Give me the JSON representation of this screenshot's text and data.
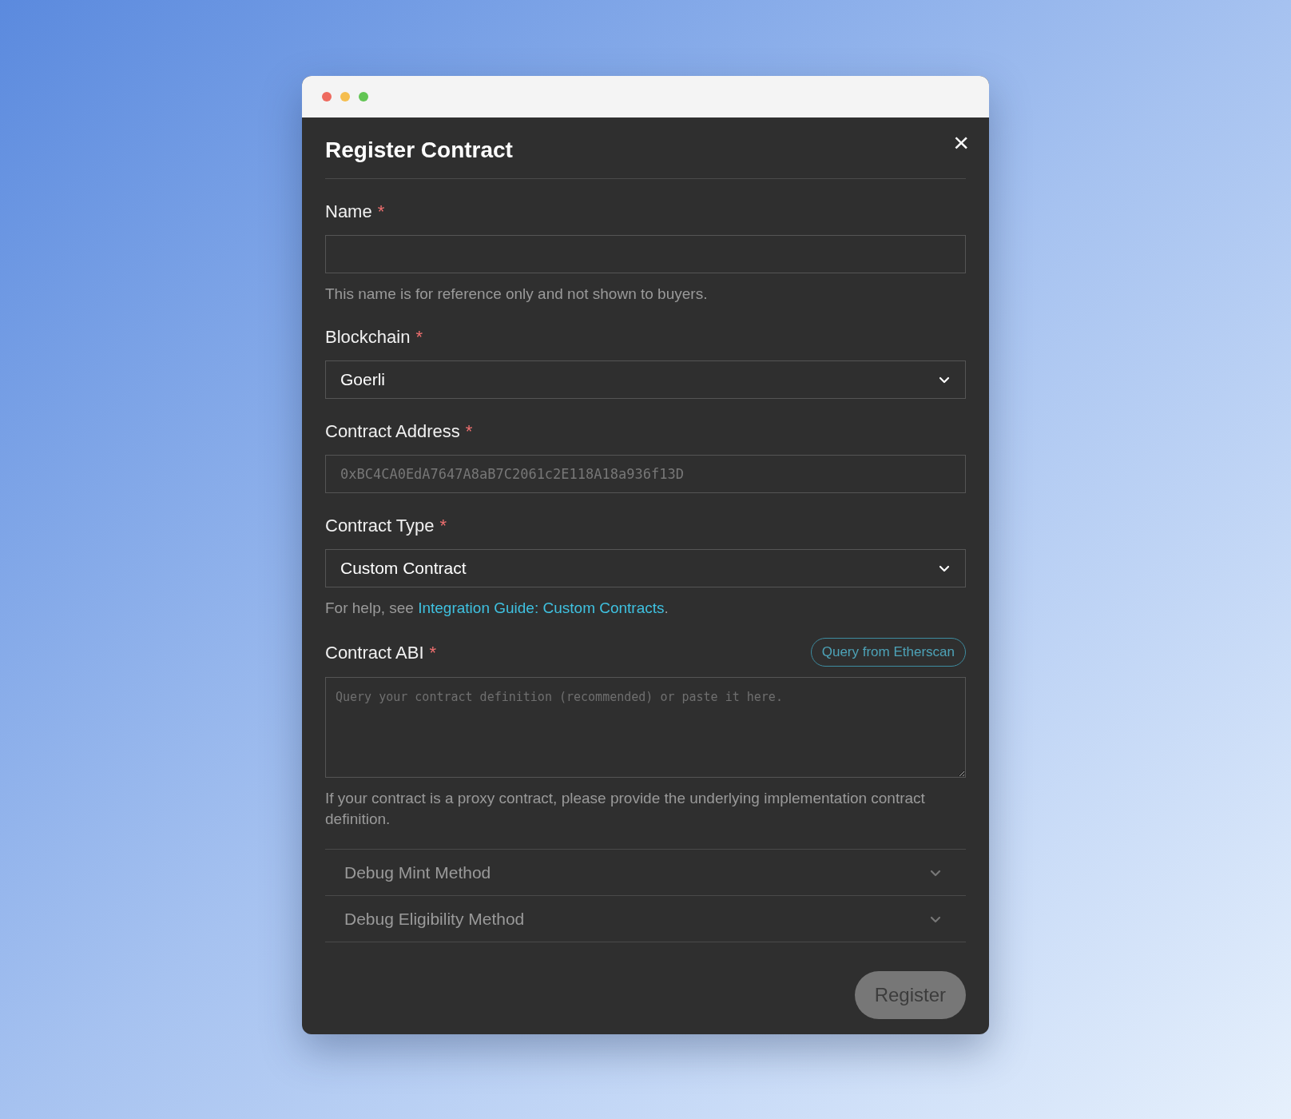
{
  "dialog": {
    "title": "Register Contract",
    "close": "×"
  },
  "fields": [
    {
      "kind": "text",
      "label": "Name",
      "required_mark": "*",
      "hint": "This name is for reference only and not shown to buyers."
    },
    {
      "kind": "select",
      "label": "Blockchain",
      "required_mark": "*",
      "value": "Goerli"
    },
    {
      "kind": "text",
      "label": "Contract Address",
      "required_mark": "*",
      "placeholder": "0xBC4CA0EdA7647A8aB7C2061c2E118A18a936f13D"
    },
    {
      "kind": "select",
      "label": "Contract Type",
      "required_mark": "*",
      "value": "Custom Contract",
      "help": {
        "prefix": "For help, see ",
        "link": "Integration Guide: Custom Contracts",
        "suffix": "."
      }
    },
    {
      "kind": "textarea",
      "label": "Contract ABI",
      "required_mark": "*",
      "action": "Query from Etherscan",
      "placeholder": "Query your contract definition (recommended) or paste it here.",
      "hint": "If your contract is a proxy contract, please provide the underlying implementation contract definition."
    }
  ],
  "sections": [
    {
      "label": "Debug Mint Method",
      "expanded": false
    },
    {
      "label": "Debug Eligibility Method",
      "expanded": false
    }
  ],
  "submit": {
    "label": "Register",
    "disabled": true
  }
}
